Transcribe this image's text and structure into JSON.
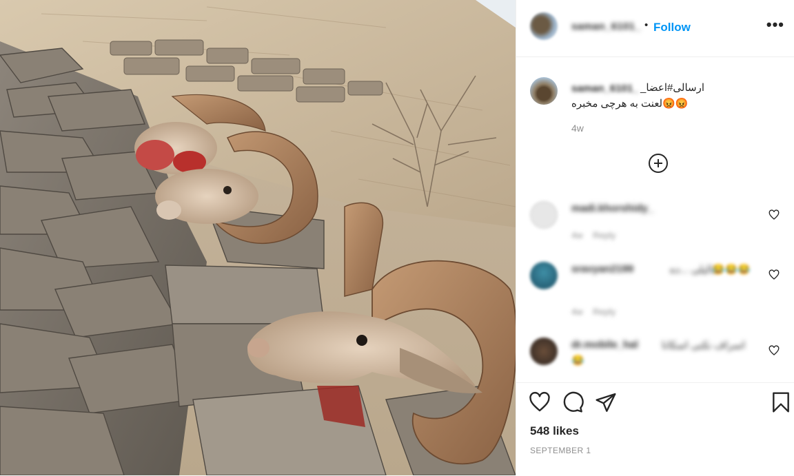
{
  "header": {
    "username": "saman_6101_",
    "separator": "•",
    "follow_label": "Follow",
    "more_label": "•••"
  },
  "caption": {
    "username": "saman_6101_",
    "line1": "ارسالی#اعضا_",
    "line2": "لعنت به هرچی مخبره",
    "emoji": "😡😡",
    "time": "4w"
  },
  "comments": [
    {
      "username": "madi.khorshidy_",
      "text": "",
      "emoji": "",
      "time": "4w",
      "reply": "Reply"
    },
    {
      "username": "sravyan2199",
      "text": "عالیلی ...ده",
      "emoji": "😂😂😂",
      "time": "4w",
      "reply": "Reply"
    },
    {
      "username": "dr.mobile_hal",
      "text": "اسراف نکنی اسکانا",
      "emoji": "😂",
      "time": "",
      "reply": ""
    }
  ],
  "footer": {
    "likes": "548 likes",
    "date": "SEPTEMBER 1"
  },
  "icons": {
    "like": "heart-outline",
    "comment": "speech-bubble",
    "share": "paper-plane",
    "save": "bookmark",
    "load_more": "plus-circle"
  },
  "colors": {
    "follow": "#0095f6",
    "text": "#262626",
    "secondary": "#8e8e8e",
    "border": "#efefef"
  }
}
